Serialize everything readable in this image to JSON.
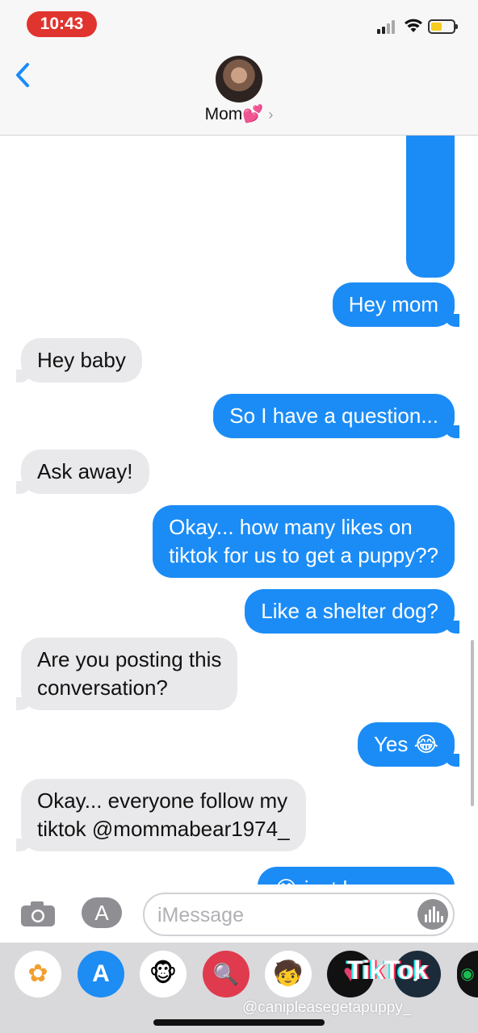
{
  "status_bar": {
    "time": "10:43",
    "signal_icon": "cellular-signal-icon",
    "wifi_icon": "wifi-icon",
    "battery_icon": "battery-low-icon",
    "battery_level": 0.35,
    "battery_color": "#f6cc1e",
    "time_pill_color": "#e0342f"
  },
  "header": {
    "back_icon": "chevron-left-icon",
    "contact_name": "Mom💕",
    "contact_chevron": "›"
  },
  "messages": [
    {
      "from": "me",
      "text": "Hey mom"
    },
    {
      "from": "them",
      "text": "Hey baby"
    },
    {
      "from": "me",
      "text": "So I have a question..."
    },
    {
      "from": "them",
      "text": "Ask away!"
    },
    {
      "from": "me",
      "lines": [
        "Okay... how many likes on",
        "tiktok for us to get a puppy??"
      ]
    },
    {
      "from": "me",
      "text": "Like a shelter dog?"
    },
    {
      "from": "them",
      "lines": [
        "Are you posting this",
        "conversation?"
      ]
    },
    {
      "from": "me",
      "text": "Yes 😂"
    },
    {
      "from": "them",
      "lines": [
        "Okay... everyone follow my",
        "tiktok @mommabear1974_"
      ]
    },
    {
      "from": "me",
      "text": "😂 just how many"
    }
  ],
  "compose": {
    "camera_icon": "camera-icon",
    "apps_icon": "app-store-icon",
    "apps_glyph": "A",
    "placeholder": "iMessage",
    "audio_icon": "audio-waveform-icon"
  },
  "app_drawer": {
    "apps": [
      {
        "name": "photos-icon",
        "glyph": "✿"
      },
      {
        "name": "app-store-icon",
        "glyph": "A"
      },
      {
        "name": "monkey-animoji-icon",
        "glyph": "🐵"
      },
      {
        "name": "web-search-icon",
        "glyph": "🔍"
      },
      {
        "name": "memoji-icon",
        "glyph": "🧒"
      },
      {
        "name": "hearts-icon",
        "glyph": "♥"
      },
      {
        "name": "tiktok-app-icon",
        "glyph": "♪"
      },
      {
        "name": "spotify-icon",
        "glyph": "◉"
      }
    ]
  },
  "watermark": {
    "brand": "TikTok",
    "username": "@canipleasegetapuppy_"
  },
  "colors": {
    "sent_bubble": "#1b8cf6",
    "received_bubble": "#e9e9eb",
    "header_background": "#f7f7f7",
    "drawer_background": "#d9d9dc"
  }
}
